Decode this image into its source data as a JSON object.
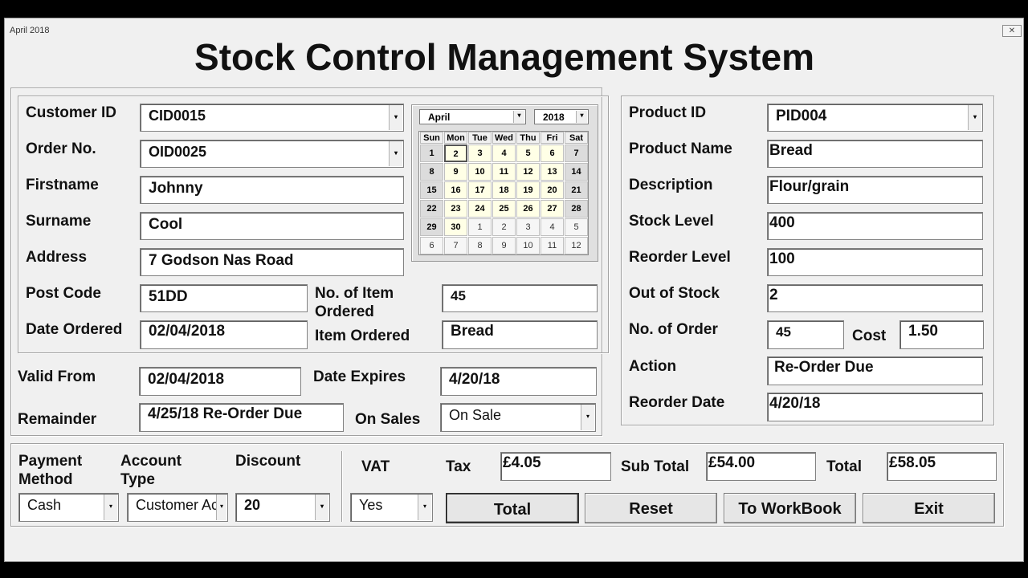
{
  "window": {
    "title": "April 2018",
    "close_icon": "close-icon"
  },
  "title": "Stock Control Management System",
  "customer": {
    "customer_id_label": "Customer ID",
    "customer_id": "CID0015",
    "order_no_label": "Order No.",
    "order_no": "OID0025",
    "firstname_label": "Firstname",
    "firstname": "Johnny",
    "surname_label": "Surname",
    "surname": "Cool",
    "address_label": "Address",
    "address": "7 Godson Nas Road",
    "postcode_label": "Post Code",
    "postcode": "51DD",
    "items_ordered_label_1": "No. of Item",
    "items_ordered_label_2": "Ordered",
    "items_ordered": "45",
    "date_ordered_label": "Date Ordered",
    "date_ordered": "02/04/2018",
    "item_ordered_label": "Item Ordered",
    "item_ordered": "Bread"
  },
  "calendar": {
    "month": "April",
    "year": "2018",
    "weekdays": [
      "Sun",
      "Mon",
      "Tue",
      "Wed",
      "Thu",
      "Fri",
      "Sat"
    ],
    "weeks": [
      [
        "1",
        "2",
        "3",
        "4",
        "5",
        "6",
        "7"
      ],
      [
        "8",
        "9",
        "10",
        "11",
        "12",
        "13",
        "14"
      ],
      [
        "15",
        "16",
        "17",
        "18",
        "19",
        "20",
        "21"
      ],
      [
        "22",
        "23",
        "24",
        "25",
        "26",
        "27",
        "28"
      ],
      [
        "29",
        "30",
        "1",
        "2",
        "3",
        "4",
        "5"
      ],
      [
        "6",
        "7",
        "8",
        "9",
        "10",
        "11",
        "12"
      ]
    ],
    "selected_day": "2"
  },
  "validity": {
    "valid_from_label": "Valid From",
    "valid_from": "02/04/2018",
    "date_expires_label": "Date Expires",
    "date_expires": "4/20/18",
    "remainder_label": "Remainder",
    "remainder": "4/25/18 Re-Order Due",
    "on_sales_label": "On Sales",
    "on_sales": "On Sale"
  },
  "product": {
    "product_id_label": "Product ID",
    "product_id": "PID004",
    "product_name_label": "Product Name",
    "product_name": "Bread",
    "description_label": "Description",
    "description": "Flour/grain",
    "stock_level_label": "Stock Level",
    "stock_level": "400",
    "reorder_level_label": "Reorder Level",
    "reorder_level": "100",
    "out_of_stock_label": "Out of Stock",
    "out_of_stock": "2",
    "no_of_order_label": "No. of Order",
    "no_of_order": "45",
    "cost_label": "Cost",
    "cost": "1.50",
    "action_label": "Action",
    "action": "Re-Order Due",
    "reorder_date_label": "Reorder Date",
    "reorder_date": "4/20/18"
  },
  "payment": {
    "payment_method_label_1": "Payment",
    "payment_method_label_2": "Method",
    "payment_method": "Cash",
    "account_type_label_1": "Account",
    "account_type_label_2": "Type",
    "account_type": "Customer Ac",
    "discount_label": "Discount",
    "discount": "20",
    "vat_label": "VAT",
    "vat": "Yes",
    "tax_label": "Tax",
    "tax": "£4.05",
    "subtotal_label": "Sub Total",
    "subtotal": "£54.00",
    "total_label": "Total",
    "total": "£58.05"
  },
  "buttons": {
    "total": "Total",
    "reset": "Reset",
    "workbook": "To WorkBook",
    "exit": "Exit"
  }
}
